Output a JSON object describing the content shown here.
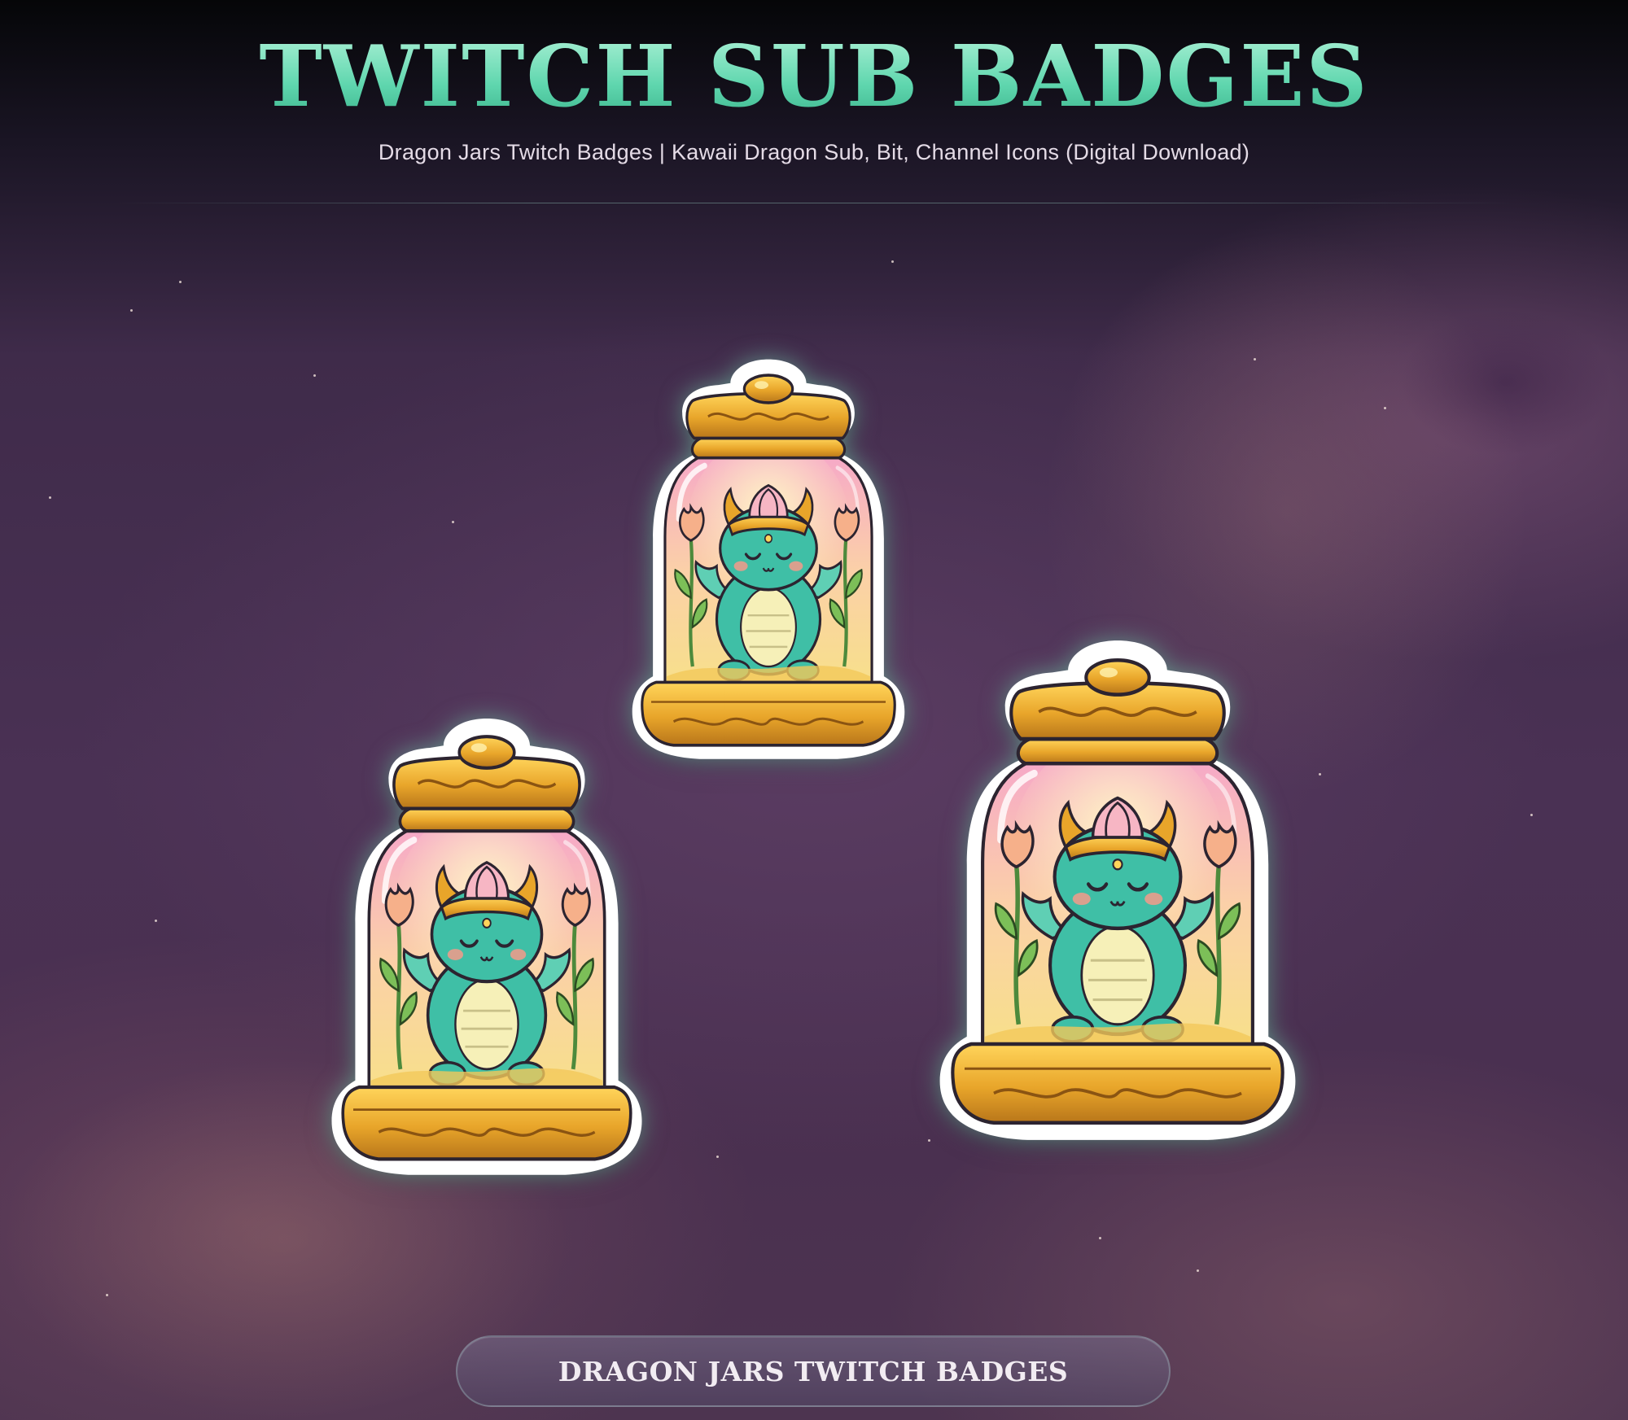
{
  "header": {
    "title": "TWITCH SUB BADGES",
    "subtitle": "Dragon Jars Twitch Badges | Kawaii Dragon Sub, Bit, Channel Icons (Digital Download)"
  },
  "badges": [
    {
      "name": "dragon-jar-badge"
    },
    {
      "name": "dragon-jar-badge"
    },
    {
      "name": "dragon-jar-badge"
    }
  ],
  "footer": {
    "label": "DRAGON JARS TWITCH BADGES"
  },
  "colors": {
    "title": "#6ddcb4",
    "background": "#4a3154",
    "glow": "#8ce6c8",
    "gold": "#e8a82a",
    "dragon": "#3fbfa6",
    "jar_pink": "#f7b6c4"
  }
}
